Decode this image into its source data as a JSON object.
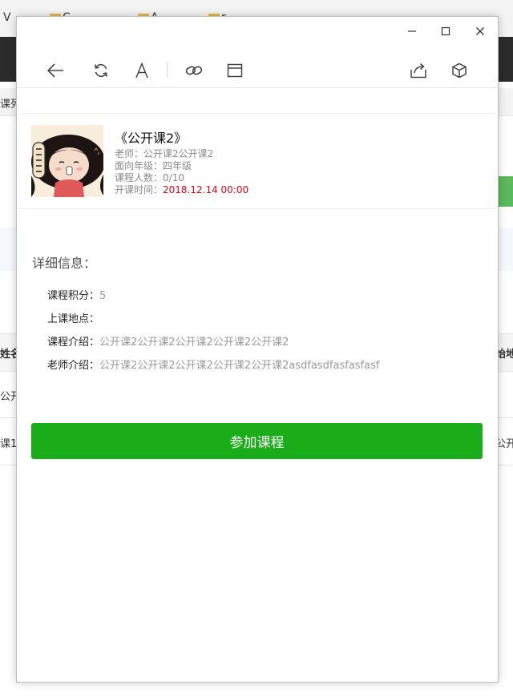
{
  "background": {
    "tabs": [
      {
        "label": "V"
      },
      {
        "label": "C"
      },
      {
        "label": "A"
      },
      {
        "label": "r"
      }
    ],
    "strip_text": "课列",
    "table": {
      "header_left": "姓名",
      "header_right": "始地",
      "rows": [
        {
          "left": "公开",
          "right": ""
        },
        {
          "left": "课1",
          "right": "公开"
        }
      ]
    }
  },
  "window": {
    "controls": {
      "minimize": "minimize-icon",
      "maximize": "maximize-icon",
      "close": "close-icon"
    },
    "toolbar": [
      "back-arrow-icon",
      "refresh-icon",
      "font-icon",
      "link-icon",
      "window-icon",
      "share-icon",
      "cube-icon"
    ]
  },
  "course": {
    "title": "《公开课2》",
    "teacher_label": "老师：",
    "teacher": "公开课2公开课2",
    "grade_label": "面向年级：",
    "grade": "四年级",
    "count_label": "课程人数：",
    "count": "0/10",
    "time_label": "开课时间：",
    "time": "2018.12.14 00:00"
  },
  "details": {
    "title": "详细信息：",
    "points_label": "课程积分：",
    "points": "5",
    "location_label": "上课地点：",
    "location": "",
    "intro_label": "课程介绍：",
    "intro": "公开课2公开课2公开课2公开课2公开课2",
    "teacher_intro_label": "老师介绍：",
    "teacher_intro": "公开课2公开课2公开课2公开课2公开课2asdfasdfasfasfasf"
  },
  "join_button": "参加课程",
  "colors": {
    "accent_green": "#1aad19",
    "time_red": "#e60012",
    "value_gray": "#999999"
  }
}
